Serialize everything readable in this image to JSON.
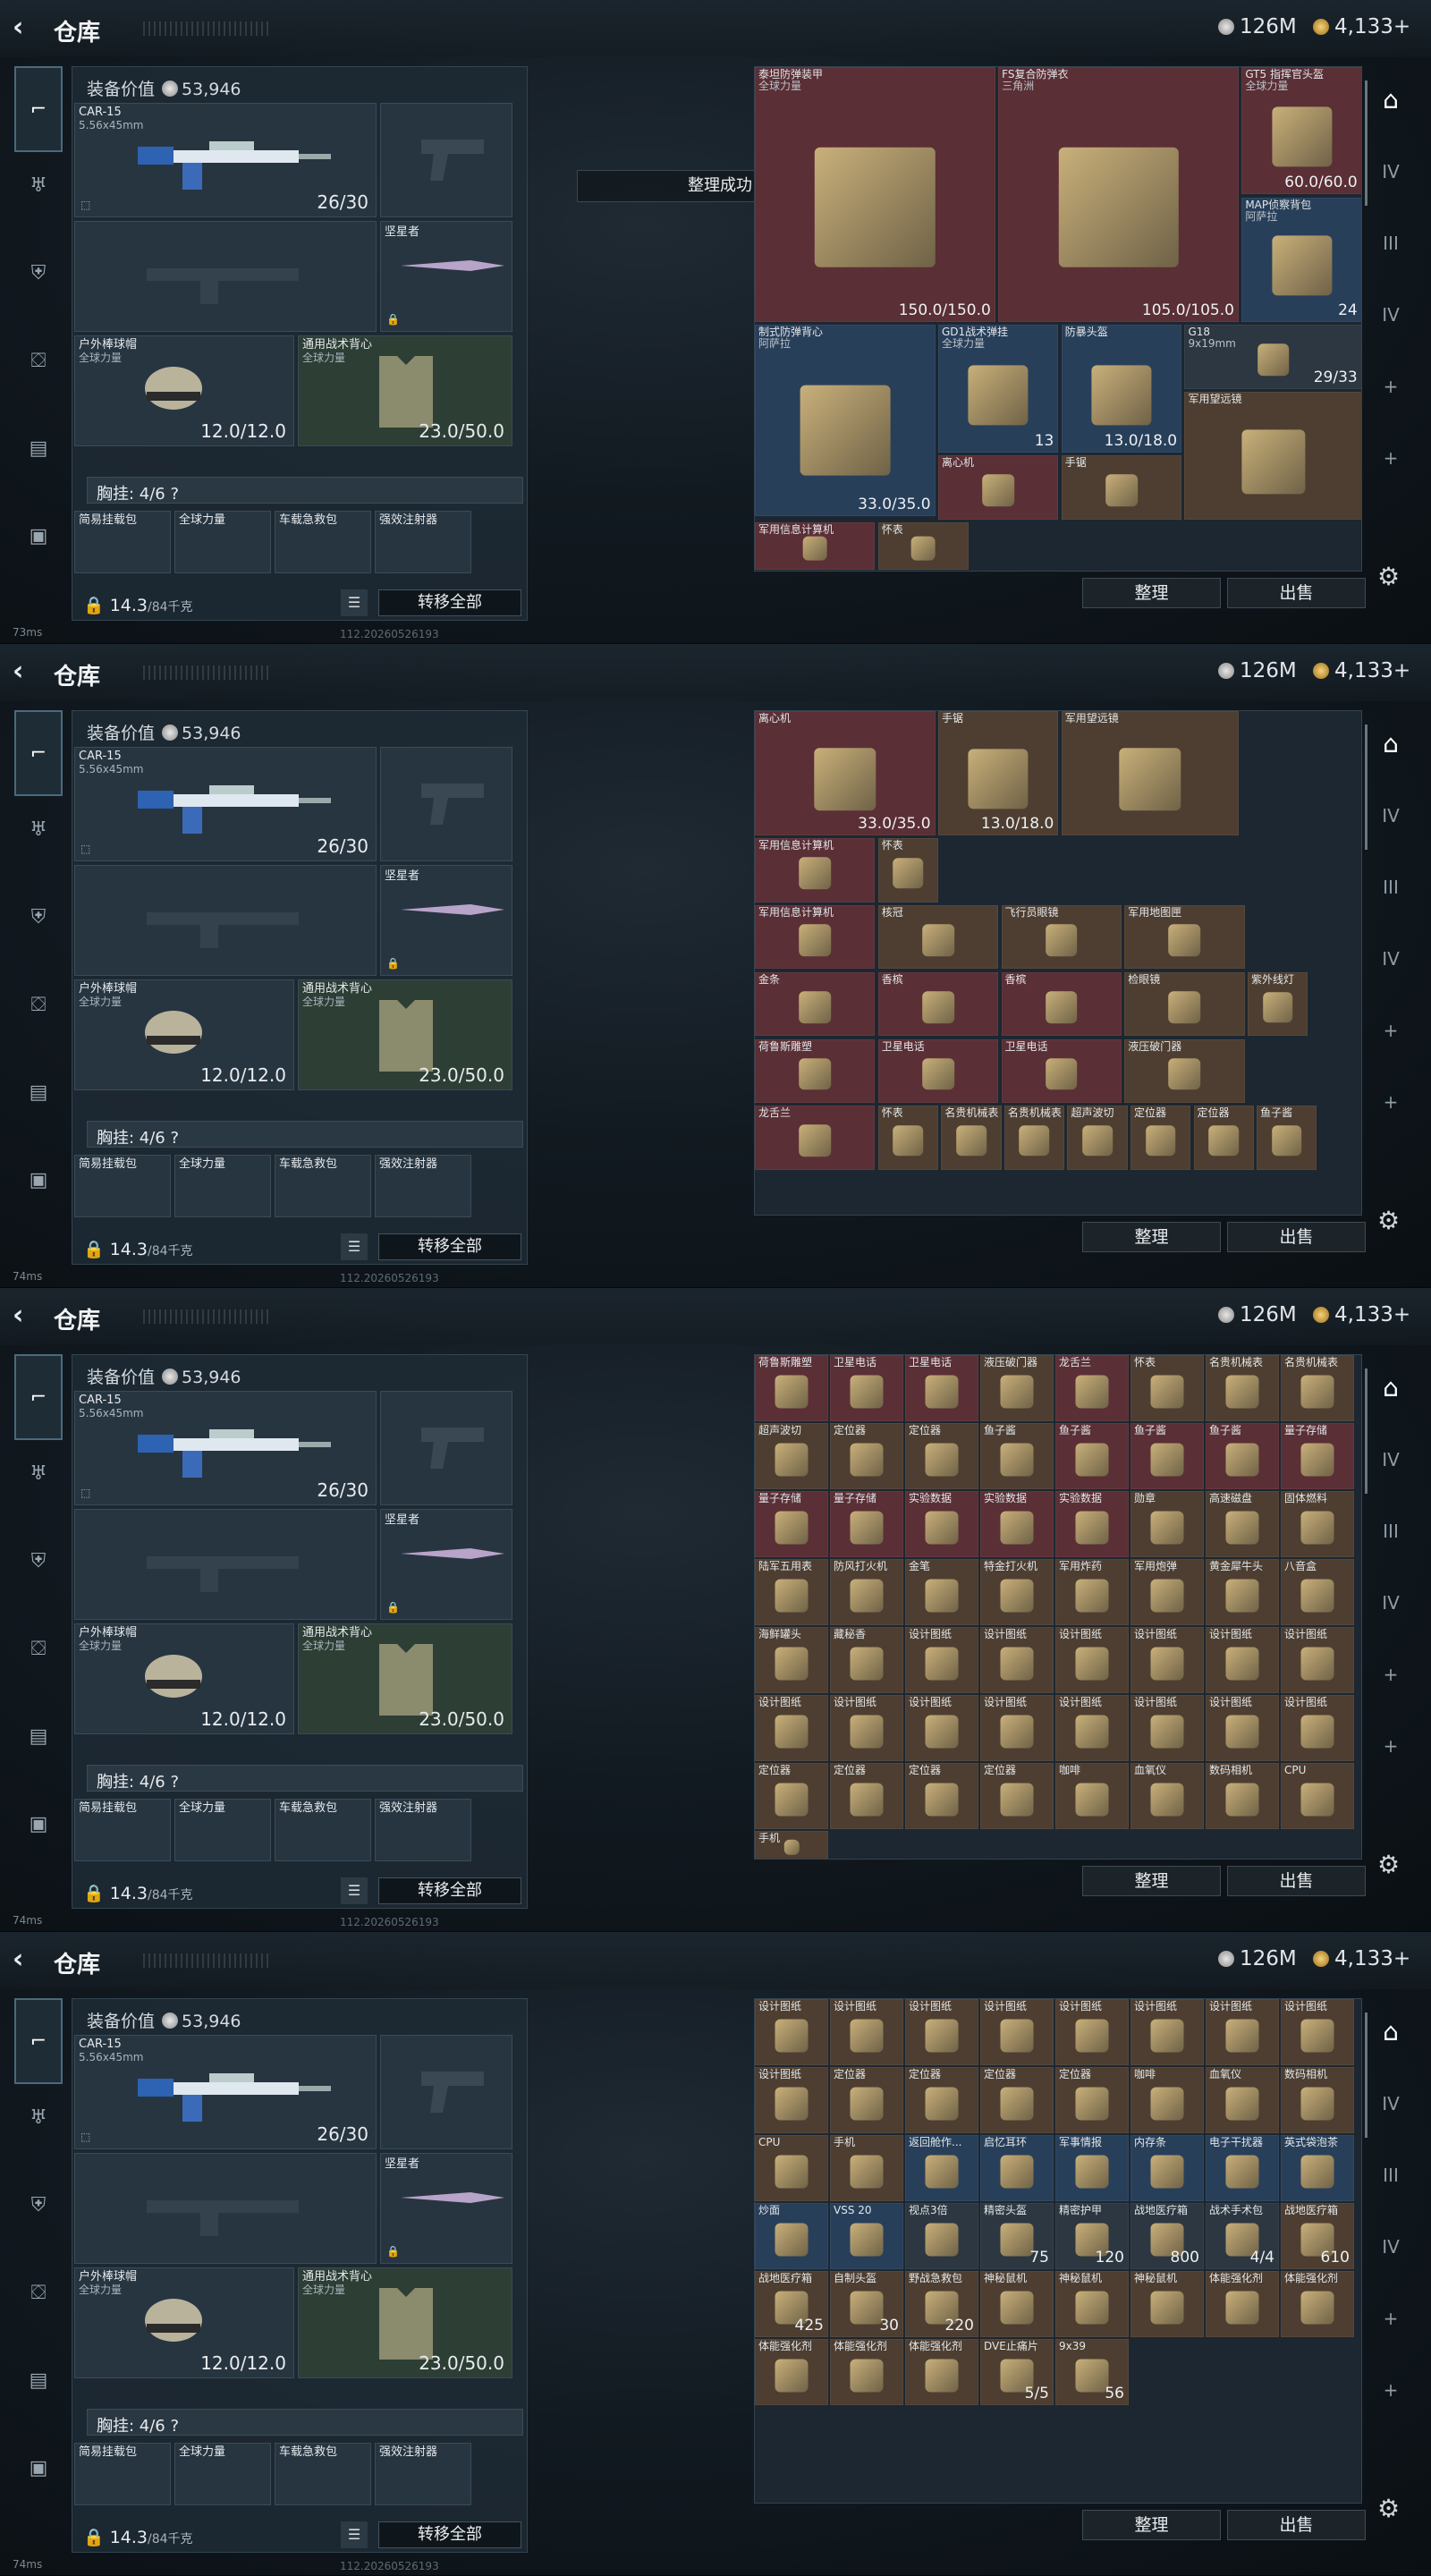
{
  "header": {
    "back_icon": "‹",
    "title": "仓库",
    "currency_silver": "126M",
    "currency_gold": "4,133+"
  },
  "sidebar": {
    "items": [
      "weapon-icon",
      "armor-icon",
      "vest-icon",
      "backpack-icon",
      "container-icon",
      "case-icon"
    ]
  },
  "loadout": {
    "equip_value_label": "装备价值",
    "equip_value": "53,946",
    "primary": {
      "name": "CAR-15",
      "caliber": "5.56x45mm",
      "ammo": "26/30"
    },
    "melee": {
      "name": "坚星者"
    },
    "helmet": {
      "name": "户外棒球帽",
      "sub": "全球力量",
      "durability": "12.0/12.0"
    },
    "vest": {
      "name": "通用战术背心",
      "sub": "全球力量",
      "durability": "23.0/50.0"
    },
    "chest_rig": "胸挂: 4/6 ?",
    "weight": "14.3",
    "weight_unit": "/84千克",
    "transfer_all": "转移全部",
    "small_items": [
      "简易挂载包",
      "全球力量",
      "车载急救包",
      "强效注射器"
    ]
  },
  "toast": "整理成功",
  "footer": {
    "ping": [
      "73ms",
      "74ms",
      "74ms",
      "74ms"
    ],
    "version": "112.20260526193"
  },
  "stash": {
    "sort_button": "整理",
    "sell_button": "出售",
    "views": [
      [
        {
          "n": "泰坦防弹装甲",
          "s": "全球力量",
          "q": "150.0/150.0",
          "c": "red"
        },
        {
          "n": "FS复合防弹衣",
          "s": "三角洲",
          "q": "105.0/105.0",
          "c": "red"
        },
        {
          "n": "GT5 指挥官头盔",
          "s": "全球力量",
          "q": "60.0/60.0",
          "c": "red"
        },
        {
          "n": "MAP侦察背包",
          "s": "阿萨拉",
          "q": "24",
          "c": "blue"
        },
        {
          "n": "制式防弹背心",
          "s": "阿萨拉",
          "q": "33.0/35.0",
          "c": "blue"
        },
        {
          "n": "GD1战术弹挂",
          "s": "全球力量",
          "q": "13",
          "c": "blue"
        },
        {
          "n": "防暴头盔",
          "s": "",
          "q": "13.0/18.0",
          "c": "blue"
        },
        {
          "n": "G18",
          "s": "9x19mm",
          "q": "29/33",
          "c": "dgrey"
        },
        {
          "n": "离心机",
          "s": "",
          "q": "",
          "c": "red"
        },
        {
          "n": "手锯",
          "s": "",
          "q": "",
          "c": "brown"
        },
        {
          "n": "军用望远镜",
          "s": "",
          "q": "",
          "c": "brown"
        },
        {
          "n": "军用信息计算机",
          "s": "",
          "q": "",
          "c": "red"
        },
        {
          "n": "怀表",
          "s": "",
          "q": "",
          "c": "brown"
        }
      ],
      [
        {
          "n": "离心机",
          "s": "",
          "q": "33.0/35.0",
          "c": "red"
        },
        {
          "n": "手锯",
          "s": "",
          "q": "13.0/18.0",
          "c": "brown"
        },
        {
          "n": "军用望远镜",
          "s": "",
          "q": "",
          "c": "brown"
        },
        {
          "n": "军用信息计算机",
          "s": "",
          "q": "",
          "c": "red"
        },
        {
          "n": "怀表",
          "s": "",
          "q": "",
          "c": "brown"
        },
        {
          "n": "军用信息计算机",
          "s": "",
          "q": "",
          "c": "red"
        },
        {
          "n": "核冠",
          "s": "",
          "q": "",
          "c": "brown"
        },
        {
          "n": "飞行员眼镜",
          "s": "",
          "q": "",
          "c": "brown"
        },
        {
          "n": "军用地图匣",
          "s": "",
          "q": "",
          "c": "brown"
        },
        {
          "n": "金条",
          "s": "",
          "q": "",
          "c": "red"
        },
        {
          "n": "香槟",
          "s": "",
          "q": "",
          "c": "red"
        },
        {
          "n": "香槟",
          "s": "",
          "q": "",
          "c": "red"
        },
        {
          "n": "检眼镜",
          "s": "",
          "q": "",
          "c": "brown"
        },
        {
          "n": "紫外线灯",
          "s": "",
          "q": "",
          "c": "brown"
        },
        {
          "n": "荷鲁斯雕塑",
          "s": "",
          "q": "",
          "c": "red"
        },
        {
          "n": "卫星电话",
          "s": "",
          "q": "",
          "c": "red"
        },
        {
          "n": "卫星电话",
          "s": "",
          "q": "",
          "c": "red"
        },
        {
          "n": "液压破门器",
          "s": "",
          "q": "",
          "c": "brown"
        },
        {
          "n": "龙舌兰",
          "s": "",
          "q": "",
          "c": "red"
        },
        {
          "n": "怀表",
          "s": "",
          "q": "",
          "c": "brown"
        },
        {
          "n": "名贵机械表",
          "s": "",
          "q": "",
          "c": "brown"
        },
        {
          "n": "名贵机械表",
          "s": "",
          "q": "",
          "c": "brown"
        },
        {
          "n": "超声波切",
          "s": "",
          "q": "",
          "c": "brown"
        },
        {
          "n": "定位器",
          "s": "",
          "q": "",
          "c": "brown"
        },
        {
          "n": "定位器",
          "s": "",
          "q": "",
          "c": "brown"
        },
        {
          "n": "鱼子酱",
          "s": "",
          "q": "",
          "c": "brown"
        }
      ],
      [
        {
          "n": "荷鲁斯雕塑",
          "s": "",
          "q": "",
          "c": "red"
        },
        {
          "n": "卫星电话",
          "s": "",
          "q": "",
          "c": "red"
        },
        {
          "n": "卫星电话",
          "s": "",
          "q": "",
          "c": "red"
        },
        {
          "n": "液压破门器",
          "s": "",
          "q": "",
          "c": "brown"
        },
        {
          "n": "龙舌兰",
          "s": "",
          "q": "",
          "c": "red"
        },
        {
          "n": "怀表",
          "s": "",
          "q": "",
          "c": "brown"
        },
        {
          "n": "名贵机械表",
          "s": "",
          "q": "",
          "c": "brown"
        },
        {
          "n": "名贵机械表",
          "s": "",
          "q": "",
          "c": "brown"
        },
        {
          "n": "超声波切",
          "s": "",
          "q": "",
          "c": "brown"
        },
        {
          "n": "定位器",
          "s": "",
          "q": "",
          "c": "brown"
        },
        {
          "n": "定位器",
          "s": "",
          "q": "",
          "c": "brown"
        },
        {
          "n": "鱼子酱",
          "s": "",
          "q": "",
          "c": "brown"
        },
        {
          "n": "鱼子酱",
          "s": "",
          "q": "",
          "c": "red"
        },
        {
          "n": "鱼子酱",
          "s": "",
          "q": "",
          "c": "red"
        },
        {
          "n": "鱼子酱",
          "s": "",
          "q": "",
          "c": "red"
        },
        {
          "n": "量子存储",
          "s": "",
          "q": "",
          "c": "red"
        },
        {
          "n": "量子存储",
          "s": "",
          "q": "",
          "c": "red"
        },
        {
          "n": "量子存储",
          "s": "",
          "q": "",
          "c": "red"
        },
        {
          "n": "实验数据",
          "s": "",
          "q": "",
          "c": "red"
        },
        {
          "n": "实验数据",
          "s": "",
          "q": "",
          "c": "red"
        },
        {
          "n": "实验数据",
          "s": "",
          "q": "",
          "c": "red"
        },
        {
          "n": "勋章",
          "s": "",
          "q": "",
          "c": "brown"
        },
        {
          "n": "高速磁盘",
          "s": "",
          "q": "",
          "c": "brown"
        },
        {
          "n": "固体燃料",
          "s": "",
          "q": "",
          "c": "brown"
        },
        {
          "n": "陆军五用表",
          "s": "",
          "q": "",
          "c": "brown"
        },
        {
          "n": "防风打火机",
          "s": "",
          "q": "",
          "c": "brown"
        },
        {
          "n": "金笔",
          "s": "",
          "q": "",
          "c": "brown"
        },
        {
          "n": "特金打火机",
          "s": "",
          "q": "",
          "c": "brown"
        },
        {
          "n": "军用炸药",
          "s": "",
          "q": "",
          "c": "brown"
        },
        {
          "n": "军用炮弹",
          "s": "",
          "q": "",
          "c": "brown"
        },
        {
          "n": "黄金犀牛头",
          "s": "",
          "q": "",
          "c": "brown"
        },
        {
          "n": "八音盒",
          "s": "",
          "q": "",
          "c": "brown"
        },
        {
          "n": "海鲜罐头",
          "s": "",
          "q": "",
          "c": "brown"
        },
        {
          "n": "藏秘香",
          "s": "",
          "q": "",
          "c": "brown"
        },
        {
          "n": "设计图纸",
          "s": "",
          "q": "",
          "c": "brown"
        },
        {
          "n": "设计图纸",
          "s": "",
          "q": "",
          "c": "brown"
        },
        {
          "n": "设计图纸",
          "s": "",
          "q": "",
          "c": "brown"
        },
        {
          "n": "设计图纸",
          "s": "",
          "q": "",
          "c": "brown"
        },
        {
          "n": "设计图纸",
          "s": "",
          "q": "",
          "c": "brown"
        },
        {
          "n": "设计图纸",
          "s": "",
          "q": "",
          "c": "brown"
        },
        {
          "n": "设计图纸",
          "s": "",
          "q": "",
          "c": "brown"
        },
        {
          "n": "设计图纸",
          "s": "",
          "q": "",
          "c": "brown"
        },
        {
          "n": "设计图纸",
          "s": "",
          "q": "",
          "c": "brown"
        },
        {
          "n": "设计图纸",
          "s": "",
          "q": "",
          "c": "brown"
        },
        {
          "n": "设计图纸",
          "s": "",
          "q": "",
          "c": "brown"
        },
        {
          "n": "设计图纸",
          "s": "",
          "q": "",
          "c": "brown"
        },
        {
          "n": "设计图纸",
          "s": "",
          "q": "",
          "c": "brown"
        },
        {
          "n": "设计图纸",
          "s": "",
          "q": "",
          "c": "brown"
        },
        {
          "n": "定位器",
          "s": "",
          "q": "",
          "c": "brown"
        },
        {
          "n": "定位器",
          "s": "",
          "q": "",
          "c": "brown"
        },
        {
          "n": "定位器",
          "s": "",
          "q": "",
          "c": "brown"
        },
        {
          "n": "定位器",
          "s": "",
          "q": "",
          "c": "brown"
        },
        {
          "n": "咖啡",
          "s": "",
          "q": "",
          "c": "brown"
        },
        {
          "n": "血氧仪",
          "s": "",
          "q": "",
          "c": "brown"
        },
        {
          "n": "数码相机",
          "s": "",
          "q": "",
          "c": "brown"
        },
        {
          "n": "CPU",
          "s": "",
          "q": "",
          "c": "brown"
        },
        {
          "n": "手机",
          "s": "",
          "q": "",
          "c": "brown"
        }
      ],
      [
        {
          "n": "设计图纸",
          "s": "",
          "q": "",
          "c": "brown"
        },
        {
          "n": "设计图纸",
          "s": "",
          "q": "",
          "c": "brown"
        },
        {
          "n": "设计图纸",
          "s": "",
          "q": "",
          "c": "brown"
        },
        {
          "n": "设计图纸",
          "s": "",
          "q": "",
          "c": "brown"
        },
        {
          "n": "设计图纸",
          "s": "",
          "q": "",
          "c": "brown"
        },
        {
          "n": "设计图纸",
          "s": "",
          "q": "",
          "c": "brown"
        },
        {
          "n": "设计图纸",
          "s": "",
          "q": "",
          "c": "brown"
        },
        {
          "n": "设计图纸",
          "s": "",
          "q": "",
          "c": "brown"
        },
        {
          "n": "设计图纸",
          "s": "",
          "q": "",
          "c": "brown"
        },
        {
          "n": "定位器",
          "s": "",
          "q": "",
          "c": "brown"
        },
        {
          "n": "定位器",
          "s": "",
          "q": "",
          "c": "brown"
        },
        {
          "n": "定位器",
          "s": "",
          "q": "",
          "c": "brown"
        },
        {
          "n": "定位器",
          "s": "",
          "q": "",
          "c": "brown"
        },
        {
          "n": "咖啡",
          "s": "",
          "q": "",
          "c": "brown"
        },
        {
          "n": "血氧仪",
          "s": "",
          "q": "",
          "c": "brown"
        },
        {
          "n": "数码相机",
          "s": "",
          "q": "",
          "c": "brown"
        },
        {
          "n": "CPU",
          "s": "",
          "q": "",
          "c": "brown"
        },
        {
          "n": "手机",
          "s": "",
          "q": "",
          "c": "brown"
        },
        {
          "n": "返回舱作...",
          "s": "",
          "q": "",
          "c": "blue"
        },
        {
          "n": "启忆耳环",
          "s": "",
          "q": "",
          "c": "blue"
        },
        {
          "n": "军事情报",
          "s": "",
          "q": "",
          "c": "blue"
        },
        {
          "n": "内存条",
          "s": "",
          "q": "",
          "c": "blue"
        },
        {
          "n": "电子干扰器",
          "s": "",
          "q": "",
          "c": "blue"
        },
        {
          "n": "英式袋泡茶",
          "s": "",
          "q": "",
          "c": "blue"
        },
        {
          "n": "炒面",
          "s": "",
          "q": "",
          "c": "blue"
        },
        {
          "n": "VSS 20",
          "s": "",
          "q": "",
          "c": "blue"
        },
        {
          "n": "视点3倍",
          "s": "",
          "q": "",
          "c": "dgrey"
        },
        {
          "n": "精密头盔",
          "s": "",
          "q": "75",
          "c": "dgrey"
        },
        {
          "n": "精密护甲",
          "s": "",
          "q": "120",
          "c": "dgrey"
        },
        {
          "n": "战地医疗箱",
          "s": "",
          "q": "800",
          "c": "dgrey"
        },
        {
          "n": "战术手术包",
          "s": "",
          "q": "4/4",
          "c": "dgrey"
        },
        {
          "n": "战地医疗箱",
          "s": "",
          "q": "610",
          "c": "brown"
        },
        {
          "n": "战地医疗箱",
          "s": "",
          "q": "425",
          "c": "brown"
        },
        {
          "n": "自制头盔",
          "s": "",
          "q": "30",
          "c": "brown"
        },
        {
          "n": "野战急救包",
          "s": "",
          "q": "220",
          "c": "brown"
        },
        {
          "n": "神秘鼠机",
          "s": "",
          "q": "",
          "c": "brown"
        },
        {
          "n": "神秘鼠机",
          "s": "",
          "q": "",
          "c": "brown"
        },
        {
          "n": "神秘鼠机",
          "s": "",
          "q": "",
          "c": "brown"
        },
        {
          "n": "体能强化剂",
          "s": "",
          "q": "",
          "c": "brown"
        },
        {
          "n": "体能强化剂",
          "s": "",
          "q": "",
          "c": "brown"
        },
        {
          "n": "体能强化剂",
          "s": "",
          "q": "",
          "c": "brown"
        },
        {
          "n": "体能强化剂",
          "s": "",
          "q": "",
          "c": "brown"
        },
        {
          "n": "体能强化剂",
          "s": "",
          "q": "",
          "c": "brown"
        },
        {
          "n": "DVE止痛片",
          "s": "",
          "q": "5/5",
          "c": "brown"
        },
        {
          "n": "9x39",
          "s": "",
          "q": "56",
          "c": "brown"
        }
      ]
    ]
  },
  "colors": {
    "red": "#5a2f35",
    "blue": "#283f5a",
    "brown": "#4d3e31",
    "dgrey": "#2c3741"
  }
}
